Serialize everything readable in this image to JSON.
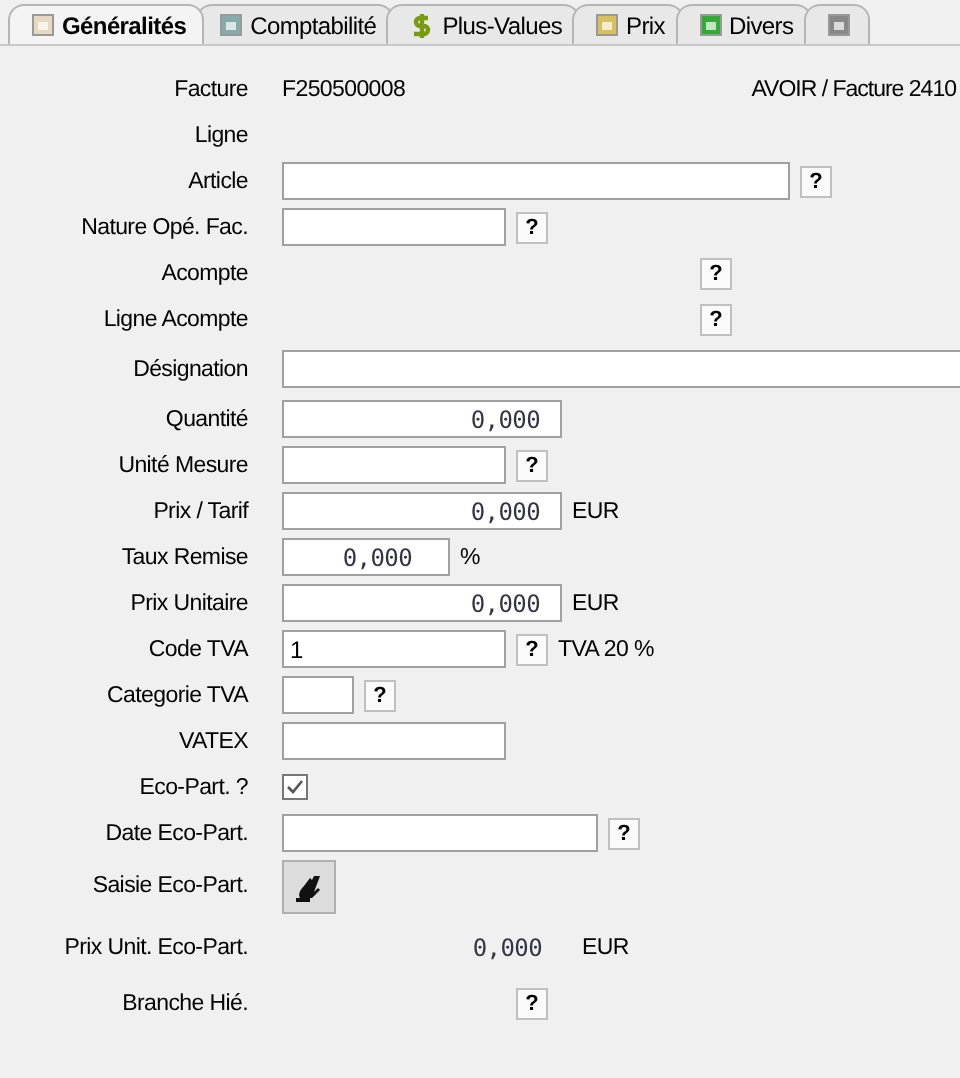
{
  "tabs": [
    {
      "label": "Généralités",
      "kind": "document",
      "selected": true
    },
    {
      "label": "Comptabilité",
      "kind": "calculator",
      "selected": false
    },
    {
      "label": "Plus-Values",
      "kind": "dollar",
      "selected": false
    },
    {
      "label": "Prix",
      "kind": "money",
      "selected": false
    },
    {
      "label": "Divers",
      "kind": "sheet",
      "selected": false
    },
    {
      "kind": "drive",
      "selected": false
    }
  ],
  "header": {
    "label": "Facture",
    "value": "F250500008",
    "note": "AVOIR / Facture 2410"
  },
  "rows": [
    {
      "label": "Ligne",
      "kind": "empty"
    },
    {
      "label": "Article",
      "kind": "field",
      "help": "?"
    },
    {
      "label": "Nature Opé. Fac.",
      "kind": "field",
      "help": "?"
    },
    {
      "label": "Acompte",
      "kind": "help",
      "help": "?"
    },
    {
      "label": "Ligne Acompte",
      "kind": "help",
      "help": "?"
    },
    {
      "label": "Désignation",
      "kind": "field"
    },
    {
      "label": "Quantité",
      "kind": "number",
      "value": "0,000"
    },
    {
      "label": "Unité Mesure",
      "kind": "field",
      "help": "?"
    },
    {
      "label": "Prix / Tarif",
      "kind": "number",
      "value": "0,000",
      "suffix": "EUR"
    },
    {
      "label": "Taux Remise",
      "kind": "number",
      "value": "0,000",
      "suffix": "%"
    },
    {
      "label": "Prix Unitaire",
      "kind": "number",
      "value": "0,000",
      "suffix": "EUR"
    },
    {
      "label": "Code TVA",
      "kind": "field",
      "value": "1",
      "help": "?",
      "suffix": "TVA 20 %"
    },
    {
      "label": "Categorie TVA",
      "kind": "field",
      "help": "?"
    },
    {
      "label": "VATEX",
      "kind": "field"
    },
    {
      "label": "Eco-Part. ?",
      "kind": "checkbox",
      "checked": true
    },
    {
      "label": "Date Eco-Part.",
      "kind": "field",
      "help": "?"
    },
    {
      "label": "Saisie Eco-Part.",
      "kind": "action"
    },
    {
      "label": "Prix Unit. Eco-Part.",
      "kind": "readout",
      "value": "0,000",
      "suffix": "EUR"
    },
    {
      "label": "Branche Hié.",
      "kind": "help",
      "help": "?"
    }
  ]
}
